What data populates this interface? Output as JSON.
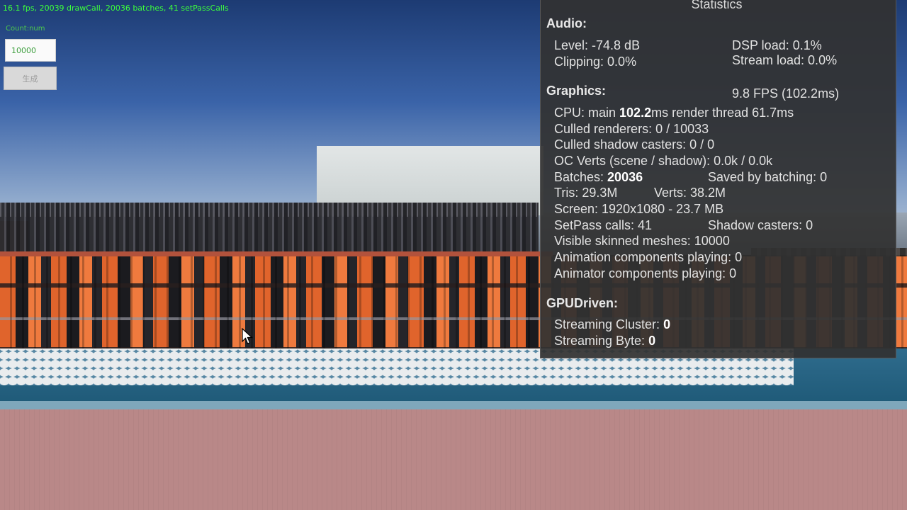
{
  "hud": {
    "fps_text": "16.1 fps, 20039 drawCall, 20036 batches, 41 setPassCalls",
    "count_label": "Count:num",
    "count_value": "10000",
    "generate_button": "生成"
  },
  "statistics": {
    "title": "Statistics",
    "audio": {
      "heading": "Audio:",
      "level": "Level: -74.8 dB",
      "dsp_load": "DSP load: 0.1%",
      "clipping": "Clipping: 0.0%",
      "stream_load": "Stream load: 0.0%"
    },
    "graphics": {
      "heading": "Graphics:",
      "fps": "9.8 FPS (102.2ms)",
      "cpu_prefix": "CPU: main ",
      "cpu_main": "102.2",
      "cpu_suffix": "ms  render thread 61.7ms",
      "culled_renderers": "Culled renderers: 0 / 10033",
      "culled_shadow": "Culled shadow casters: 0 / 0",
      "oc_verts": "OC Verts (scene / shadow): 0.0k / 0.0k",
      "batches_label": "Batches: ",
      "batches_value": "20036",
      "saved_by_batching": "Saved by batching: 0",
      "tris": "Tris: 29.3M",
      "verts": "Verts: 38.2M",
      "screen": "Screen: 1920x1080 - 23.7 MB",
      "setpass": "SetPass calls: 41",
      "shadow_casters": "Shadow casters: 0",
      "visible_skinned": "Visible skinned meshes: 10000",
      "animation_components": "Animation components playing: 0",
      "animator_components": "Animator components playing: 0"
    },
    "gpudriven": {
      "heading": "GPUDriven:",
      "streaming_cluster_label": "Streaming Cluster: ",
      "streaming_cluster_value": "0",
      "streaming_byte_label": "Streaming Byte: ",
      "streaming_byte_value": "0"
    }
  },
  "colors": {
    "hud_text": "#3cff3c",
    "panel_bg": "#323232",
    "crowd_orange": "#e0642c"
  },
  "icons": {
    "cursor": "mouse-pointer-icon"
  }
}
